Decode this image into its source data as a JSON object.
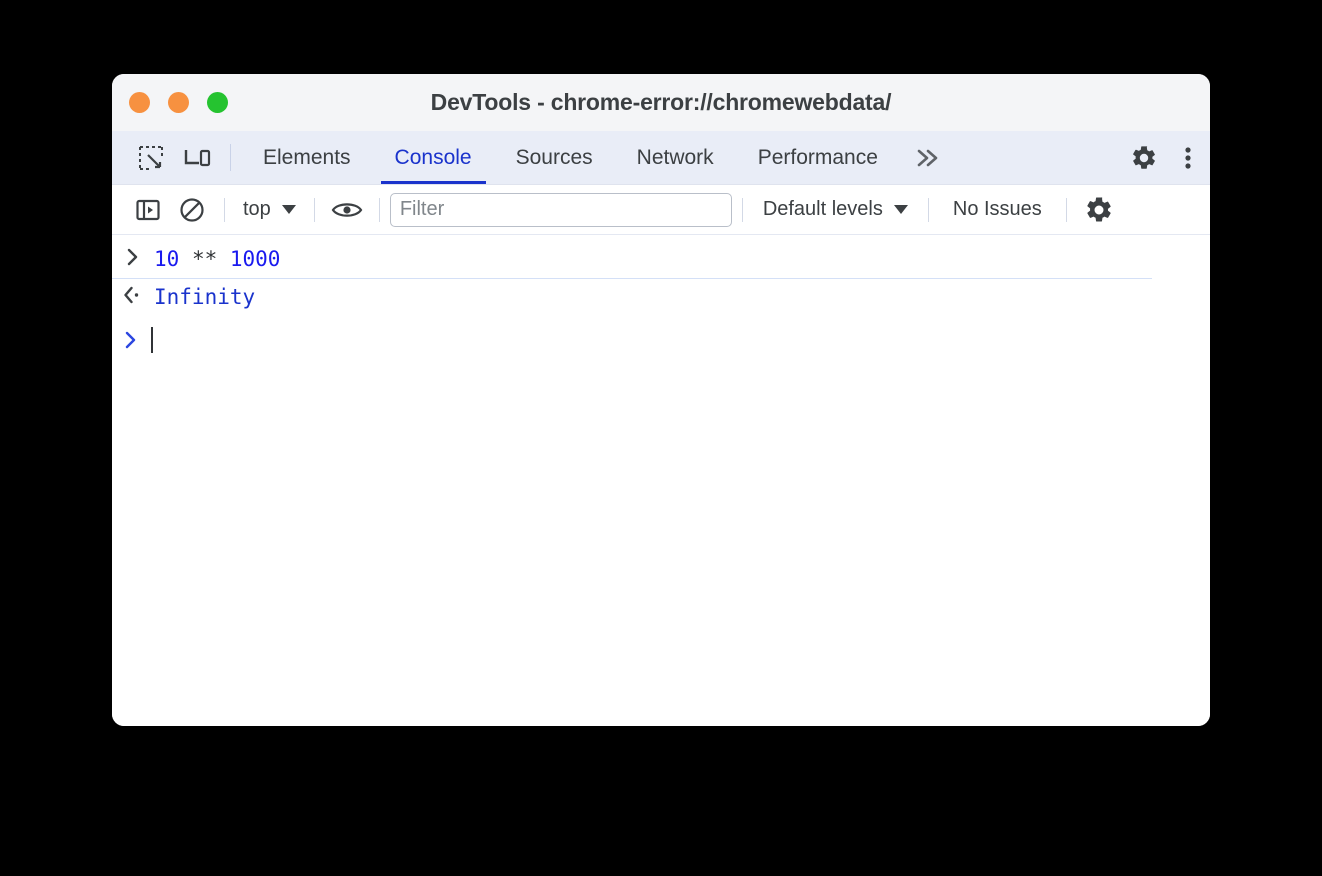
{
  "window": {
    "title": "DevTools - chrome-error://chromewebdata/",
    "traffic_lights": [
      {
        "name": "close",
        "color": "#f79140"
      },
      {
        "name": "minimize",
        "color": "#f79140"
      },
      {
        "name": "maximize",
        "color": "#25c330"
      }
    ]
  },
  "tabbar": {
    "icons": [
      {
        "name": "inspect-element-icon"
      },
      {
        "name": "device-toolbar-icon"
      }
    ],
    "tabs": [
      {
        "label": "Elements",
        "active": false
      },
      {
        "label": "Console",
        "active": true
      },
      {
        "label": "Sources",
        "active": false
      },
      {
        "label": "Network",
        "active": false
      },
      {
        "label": "Performance",
        "active": false
      }
    ],
    "more_tabs_label": "»",
    "right_icons": [
      {
        "name": "settings-gear-icon"
      },
      {
        "name": "more-options-icon"
      }
    ],
    "active_tab_color": "#1a33cc"
  },
  "console_toolbar": {
    "sidebar_toggle_name": "console-sidebar-toggle-icon",
    "clear_console_name": "clear-console-icon",
    "context_selector": "top",
    "live_expression_name": "eye-icon",
    "filter": {
      "value": "",
      "placeholder": "Filter"
    },
    "levels_label": "Default levels",
    "issues_label": "No Issues",
    "settings_name": "console-settings-gear-icon"
  },
  "console": {
    "messages": [
      {
        "type": "input",
        "marker": "›",
        "tokens": [
          {
            "text": "10",
            "kind": "num"
          },
          {
            "text": " ** ",
            "kind": "op"
          },
          {
            "text": "1000",
            "kind": "num"
          }
        ],
        "plain": "10 ** 1000"
      },
      {
        "type": "output",
        "marker": "‹·",
        "value": "Infinity"
      }
    ],
    "prompt": {
      "marker": "›",
      "value": ""
    }
  }
}
